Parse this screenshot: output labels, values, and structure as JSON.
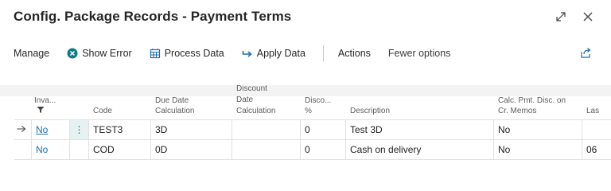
{
  "window": {
    "title": "Config. Package Records - Payment Terms"
  },
  "toolbar": {
    "manage": "Manage",
    "show_error": "Show Error",
    "process_data": "Process Data",
    "apply_data": "Apply Data",
    "actions": "Actions",
    "fewer_options": "Fewer options"
  },
  "table": {
    "headers": {
      "invalid_line1": "Inva...",
      "code": "Code",
      "due_line1": "Due Date",
      "due_line2": "Calculation",
      "disc_line1": "Discount",
      "disc_line2": "Date",
      "disc_line3": "Calculation",
      "discpct_line1": "Disco...",
      "discpct_line2": "%",
      "description": "Description",
      "calc_line1": "Calc. Pmt. Disc. on",
      "calc_line2": "Cr. Memos",
      "last": "Las"
    },
    "rows": [
      {
        "invalid": "No",
        "code": "TEST3",
        "due": "3D",
        "disc_date": "",
        "disc_pct": "0",
        "description": "Test 3D",
        "calc": "No",
        "last": ""
      },
      {
        "invalid": "No",
        "code": "COD",
        "due": "0D",
        "disc_date": "",
        "disc_pct": "0",
        "description": "Cash on delivery",
        "calc": "No",
        "last": "06"
      }
    ]
  },
  "colors": {
    "accent": "#1f6eb0",
    "error_icon": "#0f7a8a",
    "grid_line": "#e1e1e1"
  }
}
